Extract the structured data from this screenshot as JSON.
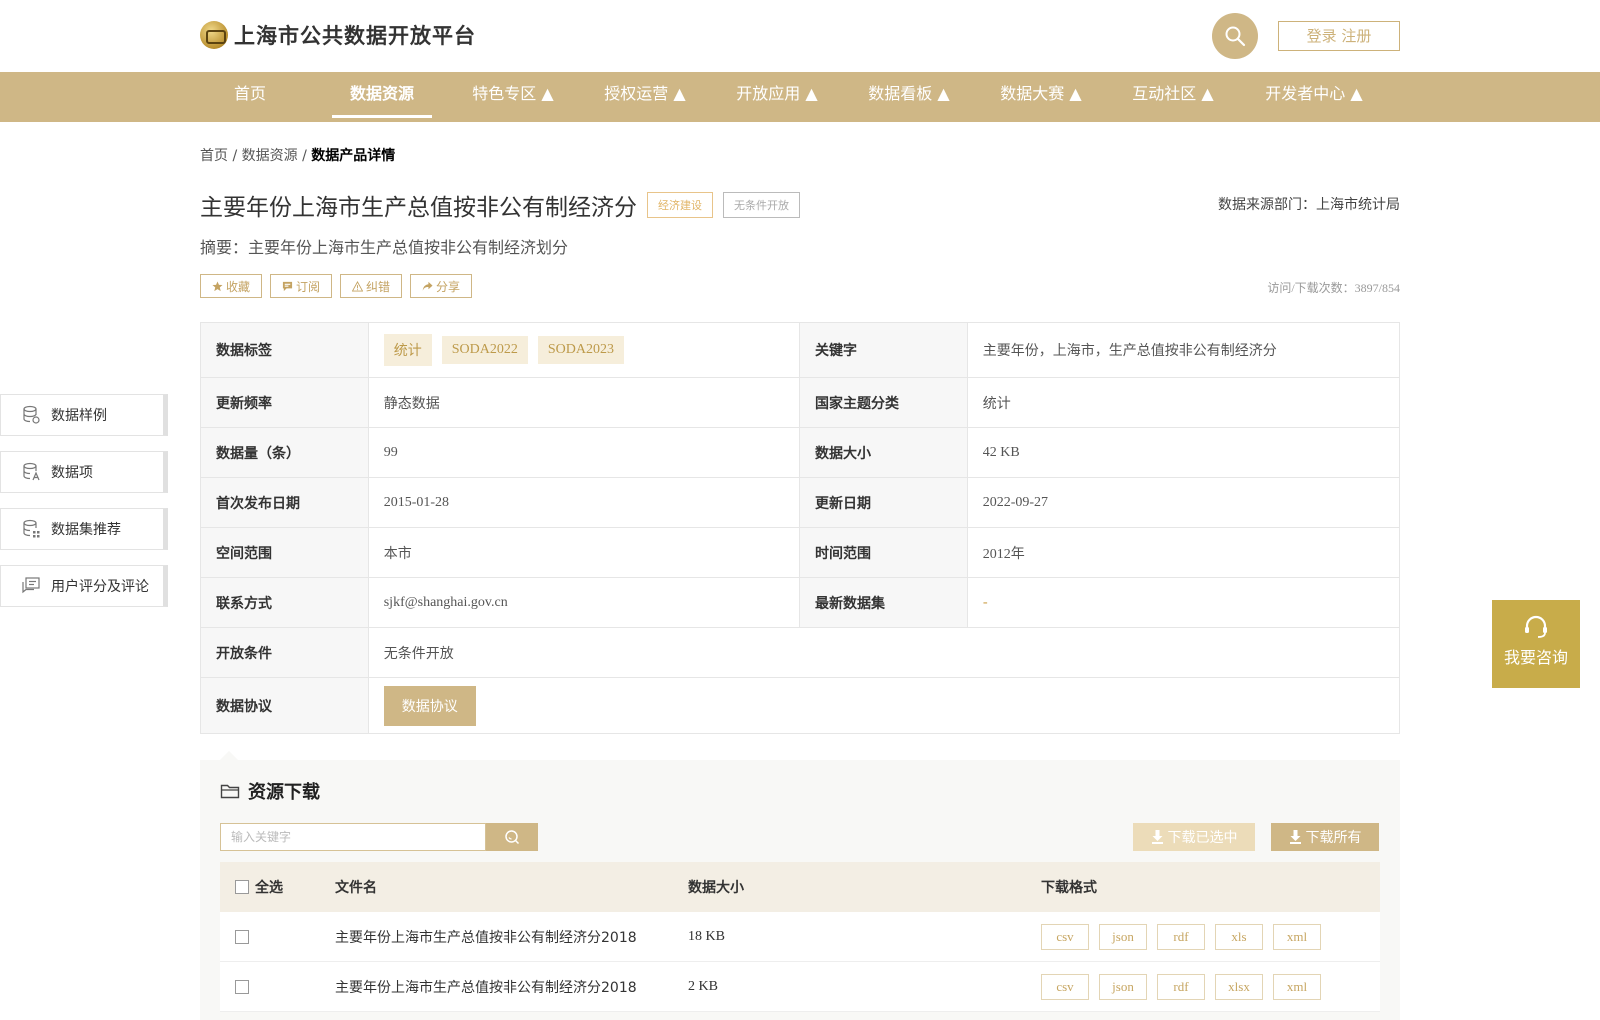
{
  "header": {
    "site_title": "上海市公共数据开放平台",
    "login_label": "登录 注册"
  },
  "nav": [
    {
      "label": "首页",
      "active": false
    },
    {
      "label": "数据资源",
      "active": true
    },
    {
      "label": "特色专区 ▲",
      "active": false
    },
    {
      "label": "授权运营 ▲",
      "active": false
    },
    {
      "label": "开放应用 ▲",
      "active": false
    },
    {
      "label": "数据看板 ▲",
      "active": false
    },
    {
      "label": "数据大赛 ▲",
      "active": false
    },
    {
      "label": "互动社区 ▲",
      "active": false
    },
    {
      "label": "开发者中心 ▲",
      "active": false
    }
  ],
  "breadcrumb": {
    "home": "首页",
    "sep1": " / ",
    "section": "数据资源",
    "sep2": " / ",
    "current": "数据产品详情"
  },
  "dataset": {
    "title": "主要年份上海市生产总值按非公有制经济分",
    "category_tag": "经济建设",
    "open_tag": "无条件开放",
    "source_dept": "数据来源部门：上海市统计局",
    "summary": "摘要：主要年份上海市生产总值按非公有制经济划分",
    "visit_download": "访问/下载次数：3897/854"
  },
  "actions": {
    "favorite": "收藏",
    "subscribe": "订阅",
    "report": "纠错",
    "share": "分享"
  },
  "info": {
    "tags_label": "数据标签",
    "tags": [
      "统计",
      "SODA2022",
      "SODA2023"
    ],
    "keywords_label": "关键字",
    "keywords": "主要年份，上海市，生产总值按非公有制经济分",
    "freq_label": "更新频率",
    "freq": "静态数据",
    "theme_label": "国家主题分类",
    "theme": "统计",
    "count_label": "数据量（条）",
    "count": "99",
    "size_label": "数据大小",
    "size": "42 KB",
    "first_pub_label": "首次发布日期",
    "first_pub": "2015-01-28",
    "updated_label": "更新日期",
    "updated": "2022-09-27",
    "space_label": "空间范围",
    "space": "本市",
    "time_label": "时间范围",
    "time": "2012年",
    "contact_label": "联系方式",
    "contact": "sjkf@shanghai.gov.cn",
    "latest_label": "最新数据集",
    "latest": "-",
    "condition_label": "开放条件",
    "condition": "无条件开放",
    "agreement_label": "数据协议",
    "agreement_btn": "数据协议"
  },
  "side_menu": [
    {
      "label": "数据样例",
      "icon": "database-sample-icon"
    },
    {
      "label": "数据项",
      "icon": "database-field-icon"
    },
    {
      "label": "数据集推荐",
      "icon": "database-recommend-icon"
    },
    {
      "label": "用户评分及评论",
      "icon": "comment-icon"
    }
  ],
  "consult": {
    "label": "我要咨询"
  },
  "resources": {
    "title": "资源下载",
    "search_placeholder": "输入关键字",
    "download_selected": "下载已选中",
    "download_all": "下载所有",
    "headers": {
      "select_all": "全选",
      "filename": "文件名",
      "size": "数据大小",
      "formats": "下载格式"
    },
    "rows": [
      {
        "filename": "主要年份上海市生产总值按非公有制经济分2018",
        "size": "18 KB",
        "formats": [
          "csv",
          "json",
          "rdf",
          "xls",
          "xml"
        ]
      },
      {
        "filename": "主要年份上海市生产总值按非公有制经济分2018",
        "size": "2 KB",
        "formats": [
          "csv",
          "json",
          "rdf",
          "xlsx",
          "xml"
        ]
      }
    ]
  },
  "colors": {
    "accent": "#cfb786",
    "consult": "#c8ac4a",
    "chip_bg": "#f6eedb"
  }
}
